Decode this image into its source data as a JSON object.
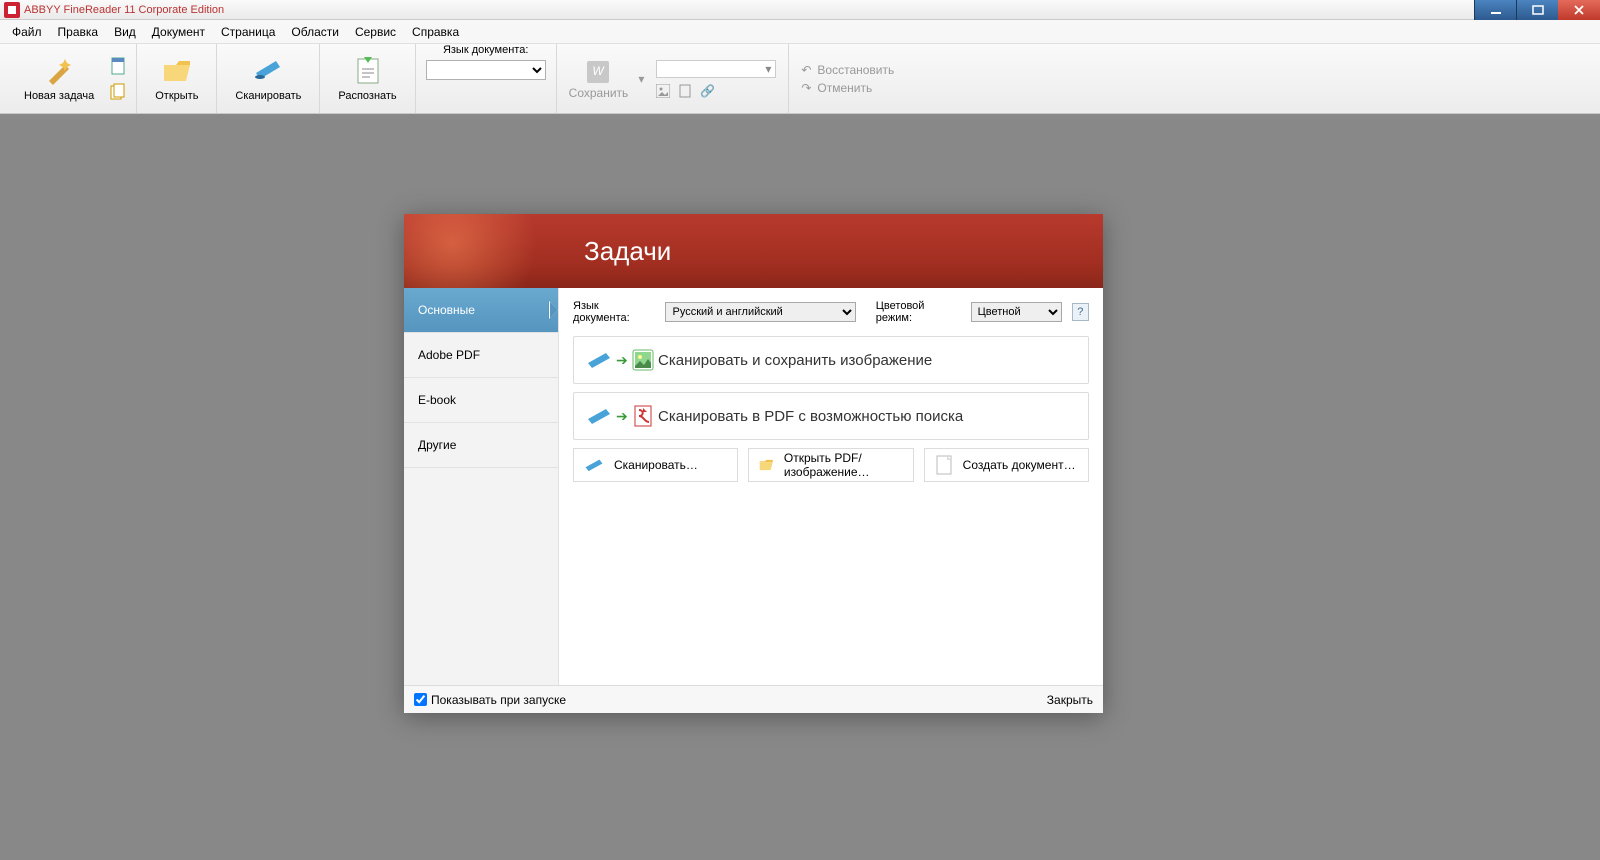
{
  "titlebar": {
    "title": "ABBYY FineReader 11 Corporate Edition"
  },
  "menubar": [
    "Файл",
    "Правка",
    "Вид",
    "Документ",
    "Страница",
    "Области",
    "Сервис",
    "Справка"
  ],
  "toolbar": {
    "new_task": "Новая задача",
    "open": "Открыть",
    "scan": "Сканировать",
    "recognize": "Распознать",
    "lang_label": "Язык документа:",
    "save": "Сохранить",
    "undo": "Восстановить",
    "redo": "Отменить"
  },
  "dialog": {
    "title": "Задачи",
    "tabs": [
      "Основные",
      "Adobe PDF",
      "E-book",
      "Другие"
    ],
    "lang_label": "Язык документа:",
    "lang_value": "Русский и английский",
    "color_label": "Цветовой режим:",
    "color_value": "Цветной",
    "tasks": [
      "Сканировать и сохранить изображение",
      "Сканировать в PDF с возможностью поиска"
    ],
    "small_buttons": [
      "Сканировать…",
      "Открыть PDF/изображение…",
      "Создать документ…"
    ],
    "show_on_start": "Показывать при запуске",
    "close": "Закрыть"
  }
}
